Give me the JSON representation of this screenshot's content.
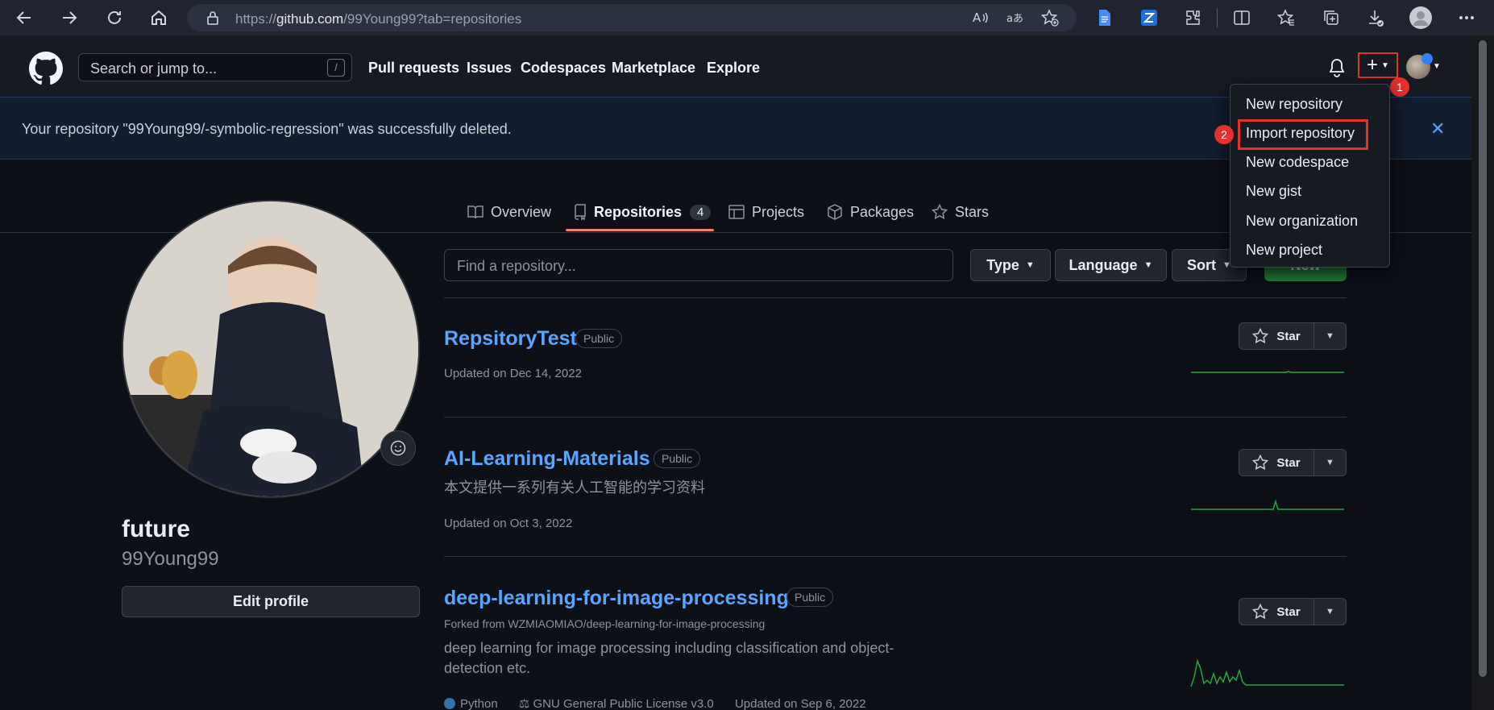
{
  "browser": {
    "url_prefix": "https://",
    "url_host": "github.com",
    "url_path": "/99Young99?tab=repositories"
  },
  "header": {
    "search_placeholder": "Search or jump to...",
    "search_shortcut": "/",
    "nav": [
      "Pull requests",
      "Issues",
      "Codespaces",
      "Marketplace",
      "Explore"
    ],
    "plus_symbol": "+",
    "annotation_1": "1",
    "annotation_2": "2"
  },
  "flash": {
    "message": "Your repository \"99Young99/-symbolic-regression\" was successfully deleted.",
    "close": "✕"
  },
  "tabs": [
    {
      "label": "Overview",
      "icon": "book-icon"
    },
    {
      "label": "Repositories",
      "icon": "repo-icon",
      "count": "4"
    },
    {
      "label": "Projects",
      "icon": "table-icon"
    },
    {
      "label": "Packages",
      "icon": "package-icon"
    },
    {
      "label": "Stars",
      "icon": "star-icon"
    }
  ],
  "profile": {
    "name": "future",
    "login": "99Young99",
    "edit_label": "Edit profile"
  },
  "filters": {
    "find_placeholder": "Find a repository...",
    "type_label": "Type",
    "language_label": "Language",
    "sort_label": "Sort",
    "new_label": "New"
  },
  "repos": [
    {
      "name": "RepsitoryTest",
      "visibility": "Public",
      "updated": "Updated on Dec 14, 2022"
    },
    {
      "name": "AI-Learning-Materials",
      "visibility": "Public",
      "description": "本文提供一系列有关人工智能的学习资料",
      "updated": "Updated on Oct 3, 2022"
    },
    {
      "name": "deep-learning-for-image-processing",
      "visibility": "Public",
      "forked_from": "Forked from WZMIAOMIAO/deep-learning-for-image-processing",
      "description_line1": "deep learning for image processing including classification and object-",
      "description_line2": "detection etc.",
      "language": "Python",
      "license": "GNU General Public License v3.0",
      "updated": "Updated on Sep 6, 2022"
    }
  ],
  "star_label": "Star",
  "dropdown": {
    "items": [
      "New repository",
      "Import repository",
      "New codespace",
      "New gist",
      "New organization",
      "New project"
    ]
  },
  "colors": {
    "link": "#58a6ff",
    "annotation_red": "#e5312c",
    "tab_underline": "#f78166",
    "language_python": "#3572A5"
  }
}
